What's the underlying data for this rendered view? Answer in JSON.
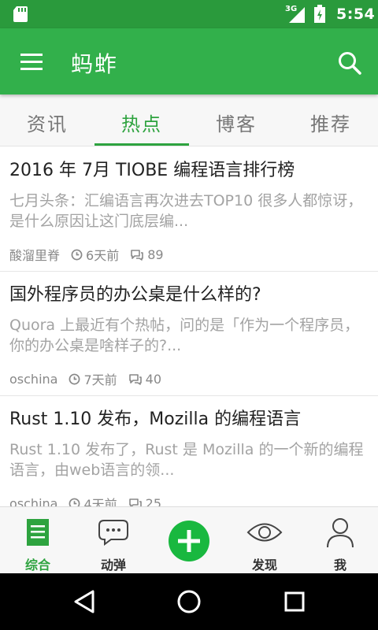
{
  "status_bar": {
    "network": "3G",
    "time": "5:54",
    "icons": [
      "sd-card-icon",
      "signal-icon",
      "battery-icon"
    ]
  },
  "app_bar": {
    "title": "蚂蚱",
    "icons": [
      "menu-icon",
      "search-icon"
    ]
  },
  "tabs": [
    {
      "label": "资讯",
      "active": false
    },
    {
      "label": "热点",
      "active": true
    },
    {
      "label": "博客",
      "active": false
    },
    {
      "label": "推荐",
      "active": false
    }
  ],
  "articles": [
    {
      "title": "2016 年 7月 TIOBE 编程语言排行榜",
      "summary": "七月头条：汇编语言再次进去TOP10 很多人都惊讶，是什么原因让这门底层编...",
      "author": "酸溜里脊",
      "time": "6天前",
      "comments": "89"
    },
    {
      "title": "国外程序员的办公桌是什么样的?",
      "summary": "Quora 上最近有个热帖，问的是「作为一个程序员，你的办公桌是啥样子的?...",
      "author": "oschina",
      "time": "7天前",
      "comments": "40"
    },
    {
      "title": "Rust 1.10 发布，Mozilla 的编程语言",
      "summary": "Rust 1.10 发布了，Rust 是 Mozilla 的一个新的编程语言，由web语言的领...",
      "author": "oschina",
      "time": "4天前",
      "comments": "25"
    }
  ],
  "bottom_nav": {
    "items": [
      {
        "label": "综合",
        "icon": "document-icon",
        "active": true
      },
      {
        "label": "动弹",
        "icon": "chat-bubble-icon",
        "active": false
      },
      {
        "label": "发现",
        "icon": "eye-icon",
        "active": false
      },
      {
        "label": "我",
        "icon": "person-icon",
        "active": false
      }
    ],
    "center_icon": "plus-icon"
  },
  "colors": {
    "status_bar": "#2a9a3c",
    "app_bar": "#32b04b",
    "accent": "#2ea33f",
    "plus_button": "#19b83f"
  }
}
